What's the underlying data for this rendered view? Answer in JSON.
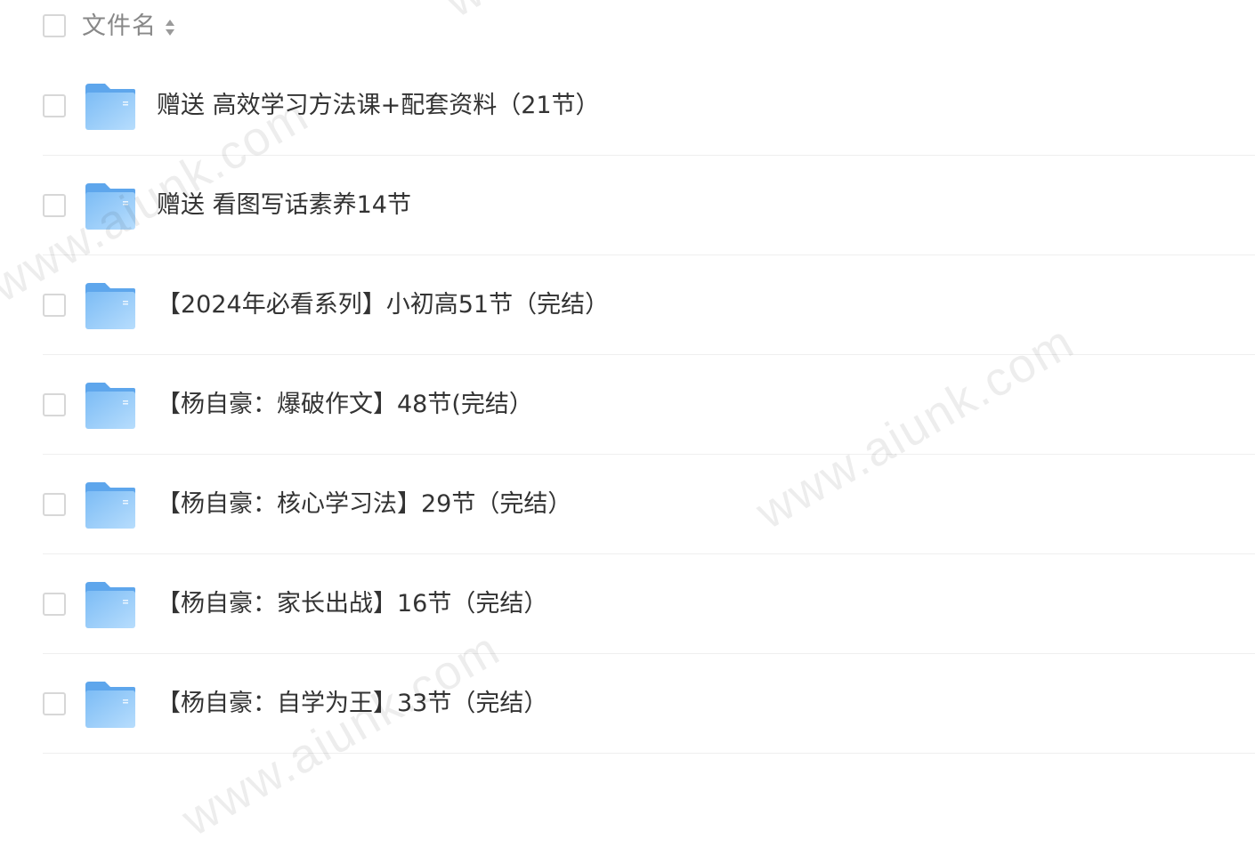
{
  "header": {
    "column_label": "文件名",
    "sort_icon": "sort-updown-icon"
  },
  "files": [
    {
      "name": "赠送 高效学习方法课+配套资料（21节）",
      "type": "folder",
      "icon": "folder-icon"
    },
    {
      "name": "赠送 看图写话素养14节",
      "type": "folder",
      "icon": "folder-icon"
    },
    {
      "name": "【2024年必看系列】小初高51节（完结）",
      "type": "folder",
      "icon": "folder-icon"
    },
    {
      "name": "【杨自豪：爆破作文】48节(完结）",
      "type": "folder",
      "icon": "folder-icon"
    },
    {
      "name": "【杨自豪：核心学习法】29节（完结）",
      "type": "folder",
      "icon": "folder-icon"
    },
    {
      "name": "【杨自豪：家长出战】16节（完结）",
      "type": "folder",
      "icon": "folder-icon"
    },
    {
      "name": "【杨自豪：自学为王】33节（完结）",
      "type": "folder",
      "icon": "folder-icon"
    }
  ],
  "watermarks": [
    "www.aiunk.com",
    "www.aiunk.com",
    "www.aiunk.com",
    "www.aiunk.com"
  ],
  "colors": {
    "text": "#333333",
    "header_text": "#888888",
    "checkbox_border": "#d7d7d7",
    "folder_light": "#a9d4fb",
    "folder_dark": "#6fb3f2",
    "divider": "#efefef"
  }
}
